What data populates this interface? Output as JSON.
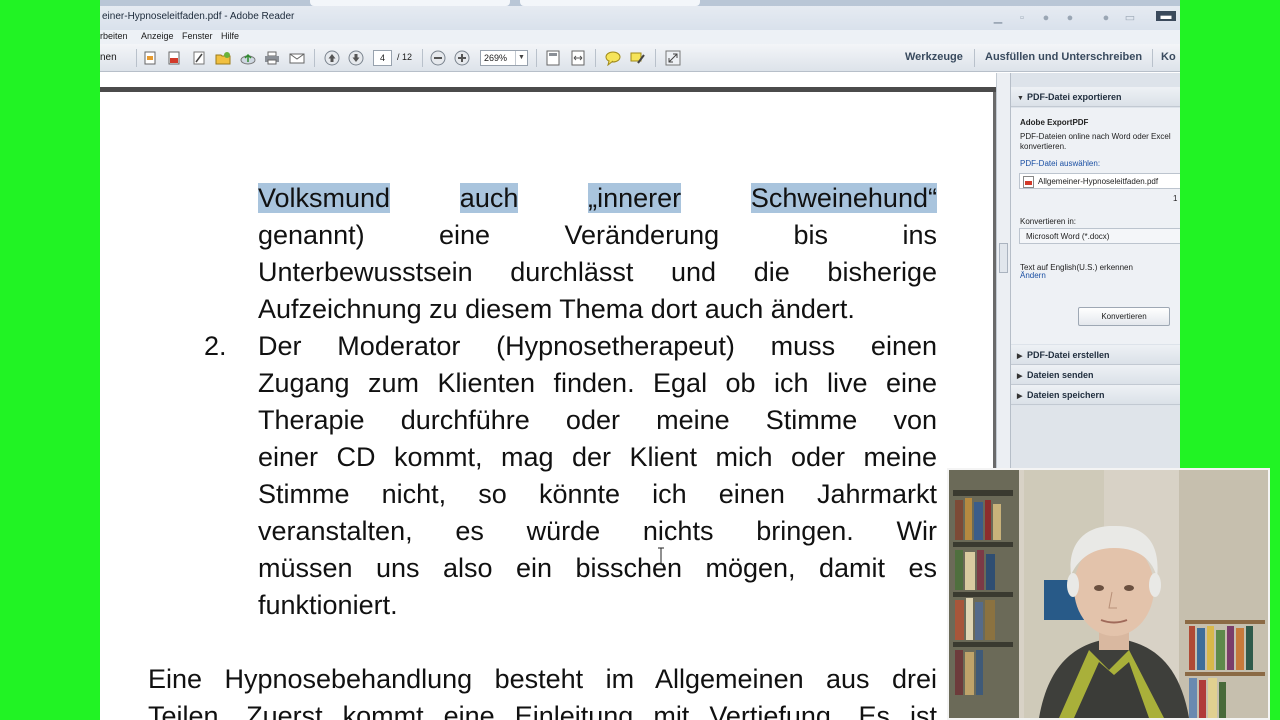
{
  "window": {
    "title": "einer-Hypnoseleitfaden.pdf - Adobe Reader"
  },
  "menu": {
    "items": [
      "rbeiten",
      "Anzeige",
      "Fenster",
      "Hilfe"
    ]
  },
  "toolbar": {
    "partial_left_label": "nen",
    "page_current": "4",
    "page_total": "/ 12",
    "zoom": "269%",
    "tools_label": "Werkzeuge",
    "fill_sign_label": "Ausfüllen und Unterschreiben",
    "comment_label": "Ko"
  },
  "document": {
    "lines": [
      {
        "segments": [
          {
            "text": "Volksmund",
            "highlight": true
          },
          {
            "text": "auch",
            "highlight": true
          },
          {
            "text": "„innerer",
            "highlight": true
          },
          {
            "text": "Schweinehund“",
            "highlight": true
          }
        ]
      },
      {
        "text": "genannt) eine Veränderung bis ins"
      },
      {
        "text": "Unterbewusstsein durchlässt und die bisherige"
      },
      {
        "text": "Aufzeichnung zu diesem Thema dort auch ändert."
      },
      {
        "text": "Der Moderator (Hypnosetherapeut) muss einen",
        "number": "2."
      },
      {
        "text": "Zugang zum Klienten finden. Egal ob ich live eine"
      },
      {
        "text": "Therapie durchführe oder meine Stimme von"
      },
      {
        "text": "einer CD kommt, mag der Klient mich oder meine"
      },
      {
        "text": "Stimme nicht, so könnte ich einen Jahrmarkt"
      },
      {
        "text": "veranstalten, es würde nichts bringen. Wir"
      },
      {
        "text": "müssen uns also ein bisschen mögen, damit es"
      },
      {
        "text": "funktioniert."
      }
    ],
    "paragraph_lines": [
      "Eine Hypnosebehandlung besteht im Allgemeinen aus drei",
      "Teilen. Zuerst kommt eine Einleitung mit Vertiefung. Es ist"
    ]
  },
  "right_pane": {
    "export_header": "PDF-Datei exportieren",
    "export_title": "Adobe ExportPDF",
    "export_desc_1": "PDF-Dateien online nach Word oder Excel",
    "export_desc_2": "konvertieren.",
    "choose_file_label": "PDF-Datei auswählen:",
    "file_name": "Allgemeiner-Hypnoseleitfaden.pdf",
    "file_count": "1",
    "convert_to_label": "Konvertieren in:",
    "convert_to_value": "Microsoft Word (*.docx)",
    "ocr_label": "Text auf English(U.S.) erkennen",
    "change_link": "Ändern",
    "convert_button": "Konvertieren",
    "sections": [
      "PDF-Datei erstellen",
      "Dateien senden",
      "Dateien speichern"
    ]
  },
  "colors": {
    "background_green": "#21f324",
    "selection_highlight": "#a9c4dd",
    "link_blue": "#1a4fa3"
  }
}
